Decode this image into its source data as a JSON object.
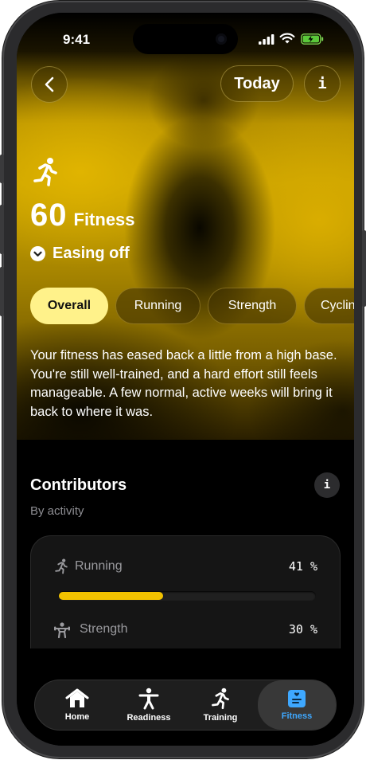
{
  "status_bar": {
    "time": "9:41"
  },
  "header": {
    "back_icon": "chevron-left-icon",
    "today_label": "Today",
    "info_label": "i"
  },
  "hero": {
    "icon": "running-icon",
    "score": "60",
    "score_label": "Fitness",
    "trend_icon": "chevron-down-circle-icon",
    "trend_label": "Easing off",
    "accent_color": "#f2c200"
  },
  "tabs": [
    {
      "label": "Overall",
      "active": true
    },
    {
      "label": "Running",
      "active": false
    },
    {
      "label": "Strength",
      "active": false
    },
    {
      "label": "Cyclin",
      "active": false
    }
  ],
  "description": "Your fitness has eased back a little from a high base. You're still well-trained, and a hard effort still feels manageable. A few normal, active weeks will bring it back to where it was.",
  "contributors": {
    "title": "Contributors",
    "subtitle": "By activity",
    "info_label": "i",
    "items": [
      {
        "name": "Running",
        "icon": "running-icon",
        "percent": "41 %",
        "progress": 0.41
      },
      {
        "name": "Strength",
        "icon": "weightlifting-icon",
        "percent": "30 %",
        "progress": 0.3
      }
    ]
  },
  "nav": [
    {
      "label": "Home",
      "icon": "home-icon",
      "active": false
    },
    {
      "label": "Readiness",
      "icon": "person-icon",
      "active": false
    },
    {
      "label": "Training",
      "icon": "running-icon",
      "active": false
    },
    {
      "label": "Fitness",
      "icon": "fitness-card-icon",
      "active": true
    }
  ]
}
